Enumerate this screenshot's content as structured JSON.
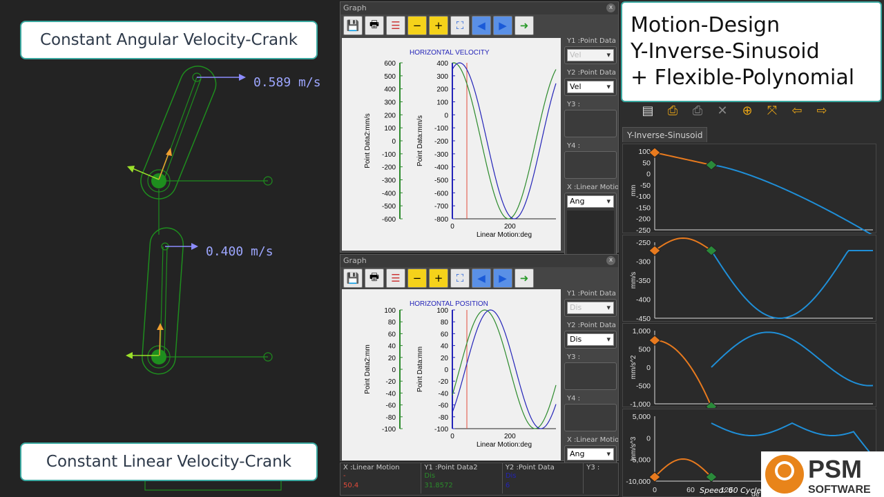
{
  "mechanism": {
    "top_title": "Constant Angular Velocity-Crank",
    "bottom_title": "Constant Linear Velocity-Crank",
    "top_speed": "0.589 m/s",
    "bottom_speed": "0.400 m/s"
  },
  "graph_top": {
    "window_title": "Graph",
    "close": "x",
    "plot_title": "HORIZONTAL VELOCITY",
    "y2_axis_label": "Point Data2:mm/s",
    "y_axis_label": "Point Data:mm/s",
    "x_axis_label": "Linear Motion:deg",
    "y2_ticks": [
      "600",
      "500",
      "400",
      "300",
      "200",
      "100",
      "0",
      "-100",
      "-200",
      "-300",
      "-400",
      "-500",
      "-600"
    ],
    "y_ticks": [
      "400",
      "300",
      "200",
      "100",
      "0",
      "-100",
      "-200",
      "-300",
      "-400",
      "-500",
      "-600",
      "-700",
      "-800"
    ],
    "x_ticks": [
      "0",
      "200"
    ],
    "panel": {
      "y1_label": "Y1 :Point Data",
      "y1_value": "Vel",
      "y2_label": "Y2 :Point Data",
      "y2_value": "Vel",
      "y3_label": "Y3 :",
      "y4_label": "Y4 :",
      "x_label": "X :Linear Motio",
      "x_value": "Ang"
    }
  },
  "graph_bottom": {
    "window_title": "Graph",
    "close": "x",
    "plot_title": "HORIZONTAL POSITION",
    "y2_axis_label": "Point Data2:mm",
    "y_axis_label": "Point Data:mm",
    "x_axis_label": "Linear Motion:deg",
    "y2_ticks": [
      "100",
      "80",
      "60",
      "40",
      "20",
      "0",
      "-20",
      "-40",
      "-60",
      "-80",
      "-100"
    ],
    "y_ticks": [
      "100",
      "80",
      "60",
      "40",
      "20",
      "0",
      "-20",
      "-40",
      "-60",
      "-80",
      "-100"
    ],
    "x_ticks": [
      "0",
      "200"
    ],
    "panel": {
      "y1_label": "Y1 :Point Data",
      "y1_value": "Dis",
      "y2_label": "Y2 :Point Data",
      "y2_value": "Dis",
      "y3_label": "Y3 :",
      "y4_label": "Y4 :",
      "x_label": "X :Linear Motio",
      "x_value": "Ang"
    }
  },
  "readout": {
    "c1_head": "X :Linear Motion",
    "c1_v1": "-",
    "c1_v2": "50.4",
    "c2_head": "Y1 :Point Data2",
    "c2_v1": "Dis",
    "c2_v2": "31.8572",
    "c3_head": "Y2 :Point Data",
    "c3_v1": "Dis",
    "c3_v2": "6",
    "c4_head": "Y3 :"
  },
  "motion_design": {
    "line1": "Motion-Design",
    "line2": "Y-Inverse-Sinusoid",
    "line3": "+ Flexible-Polynomial",
    "tab": "Y-Inverse-Sinusoid",
    "g1_ticks": [
      "100",
      "50",
      "0",
      "-50",
      "-100",
      "-150",
      "-200",
      "-250"
    ],
    "g1_unit": "mm",
    "g2_ticks": [
      "-250",
      "-300",
      "-350",
      "-400",
      "-450"
    ],
    "g2_unit": "mm/s",
    "g3_ticks": [
      "1,000",
      "500",
      "0",
      "-500",
      "-1,000"
    ],
    "g3_unit": "mm/s^2",
    "g4_ticks": [
      "5,000",
      "0",
      "-5,000",
      "-10,000"
    ],
    "g4_unit": "mm/s^3",
    "x_ticks": [
      "0",
      "60",
      "120"
    ],
    "x_label": "de",
    "speed_text": "Speed: 60 Cycles"
  },
  "logo": {
    "main": "PSM",
    "sub": "SOFTWARE"
  },
  "colors": {
    "green_line": "#2b8a2b",
    "blue_line": "#2323b8",
    "red_marker": "#e24a3a",
    "orange_curve": "#e87a1e",
    "blue_curve": "#1f8fd8",
    "mech_green": "#1e8e1e"
  }
}
